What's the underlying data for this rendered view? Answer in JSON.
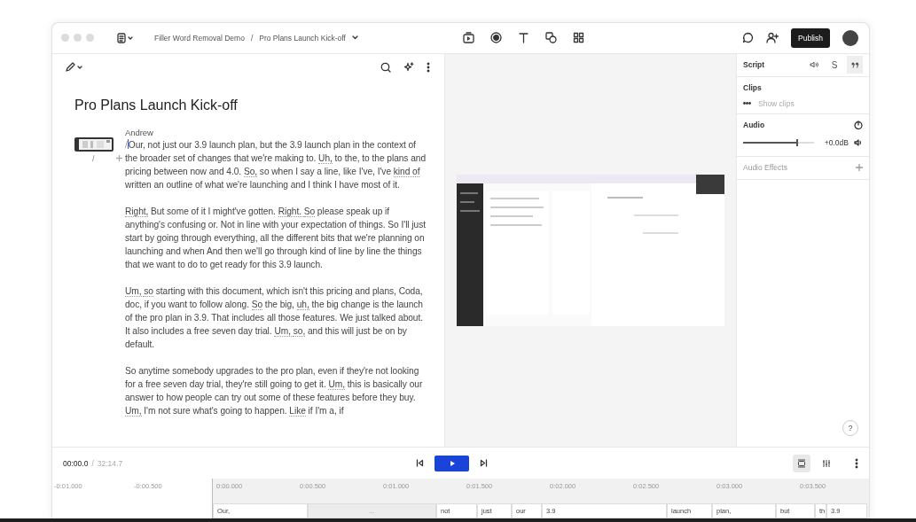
{
  "window": {
    "breadcrumb": [
      {
        "label": "Filler Word Removal Demo"
      },
      {
        "label": "Pro Plans Launch Kick-off"
      }
    ],
    "breadcrumb_separator": "/",
    "publish": "Publish"
  },
  "editor": {
    "title": "Pro Plans Launch Kick-off",
    "speaker": "Andrew",
    "clip_marker": "/",
    "cursor_prefix": "/",
    "paragraphs": [
      [
        {
          "t": "Our, not just our 3.9 launch plan, but the 3.9 launch plan in the context of the broader set of changes that we're making to. ",
          "filler": false
        },
        {
          "t": "Uh,",
          "filler": true
        },
        {
          "t": " to the, to the plans and pricing between now and 4.0. ",
          "filler": false
        },
        {
          "t": "So,",
          "filler": true
        },
        {
          "t": " so when I say a line, like I've, I've ",
          "filler": false
        },
        {
          "t": "kind of",
          "filler": true
        },
        {
          "t": " written an outline of what we're launching and I think I have most of it.",
          "filler": false
        }
      ],
      [
        {
          "t": "Right,",
          "filler": true
        },
        {
          "t": " But some of it I might've gotten. ",
          "filler": false
        },
        {
          "t": "Right. ",
          "filler": true
        },
        {
          "t": "So",
          "filler": true
        },
        {
          "t": " please speak up if anything's confusing or. Not in line with your expectation of things. So I'll just start by going through everything, all the different bits that we're planning on launching and when And then we'll go through kind of line by line the things that we want to do to get ready for this 3.9 launch.",
          "filler": false
        }
      ],
      [
        {
          "t": "Um, ",
          "filler": true
        },
        {
          "t": "so",
          "filler": true
        },
        {
          "t": " starting with this document, which isn't this pricing and plans, Coda, doc, if you want to follow along. ",
          "filler": false
        },
        {
          "t": "So",
          "filler": true
        },
        {
          "t": " the big, ",
          "filler": false
        },
        {
          "t": "uh,",
          "filler": true
        },
        {
          "t": " the big change is the launch of the pro plan in 3.9. That includes all those features. We just talked about. It also includes a free seven day trial. ",
          "filler": false
        },
        {
          "t": "Um, ",
          "filler": true
        },
        {
          "t": "so,",
          "filler": true
        },
        {
          "t": " and this will just be on by default.",
          "filler": false
        }
      ],
      [
        {
          "t": "So anytime somebody upgrades to the pro plan, even if they're not looking for a free seven day trial, they're still going to get it. ",
          "filler": false
        },
        {
          "t": "Um,",
          "filler": true
        },
        {
          "t": " this is basically our answer to how people can try out some of these features before they buy. ",
          "filler": false
        },
        {
          "t": "Um,",
          "filler": true
        },
        {
          "t": " I'm not sure what's going to happen. ",
          "filler": false
        },
        {
          "t": "Like",
          "filler": true
        },
        {
          "t": " if I'm a, if",
          "filler": false
        }
      ]
    ]
  },
  "right_panel": {
    "script": {
      "title": "Script",
      "tabs": [
        {
          "kind": "speaker",
          "selected": false
        },
        {
          "kind": "letter",
          "label": "S",
          "selected": false
        },
        {
          "kind": "quote",
          "selected": true
        }
      ]
    },
    "clips": {
      "title": "Clips",
      "action": "Show clips"
    },
    "audio": {
      "title": "Audio",
      "level": 0.75,
      "reading": "+0.0dB"
    },
    "effects": {
      "title": "Audio Effects"
    },
    "help": "?"
  },
  "transport": {
    "current": "00:00.0",
    "separator": "/",
    "total": "32:14.7",
    "views": [
      {
        "kind": "stack",
        "selected": true
      },
      {
        "kind": "sliders",
        "selected": false
      }
    ]
  },
  "timeline": {
    "pre_ticks": [
      "-0:01.000",
      "-0:00.500"
    ],
    "ticks": [
      "0:00.000",
      "0:00.500",
      "0:01.000",
      "0:01.500",
      "0:02.000",
      "0:02.500",
      "0:03.000",
      "0:03.500"
    ],
    "words": [
      {
        "text": "Our,",
        "kind": "word"
      },
      {
        "text": "...",
        "kind": "gap"
      },
      {
        "text": "not",
        "kind": "word"
      },
      {
        "text": "just",
        "kind": "word"
      },
      {
        "text": "our",
        "kind": "word"
      },
      {
        "text": "3.9",
        "kind": "word"
      },
      {
        "text": "launch",
        "kind": "word"
      },
      {
        "text": "plan,",
        "kind": "word"
      },
      {
        "text": "but",
        "kind": "word"
      },
      {
        "text": "th",
        "kind": "word"
      },
      {
        "text": "3.9",
        "kind": "word"
      }
    ]
  }
}
